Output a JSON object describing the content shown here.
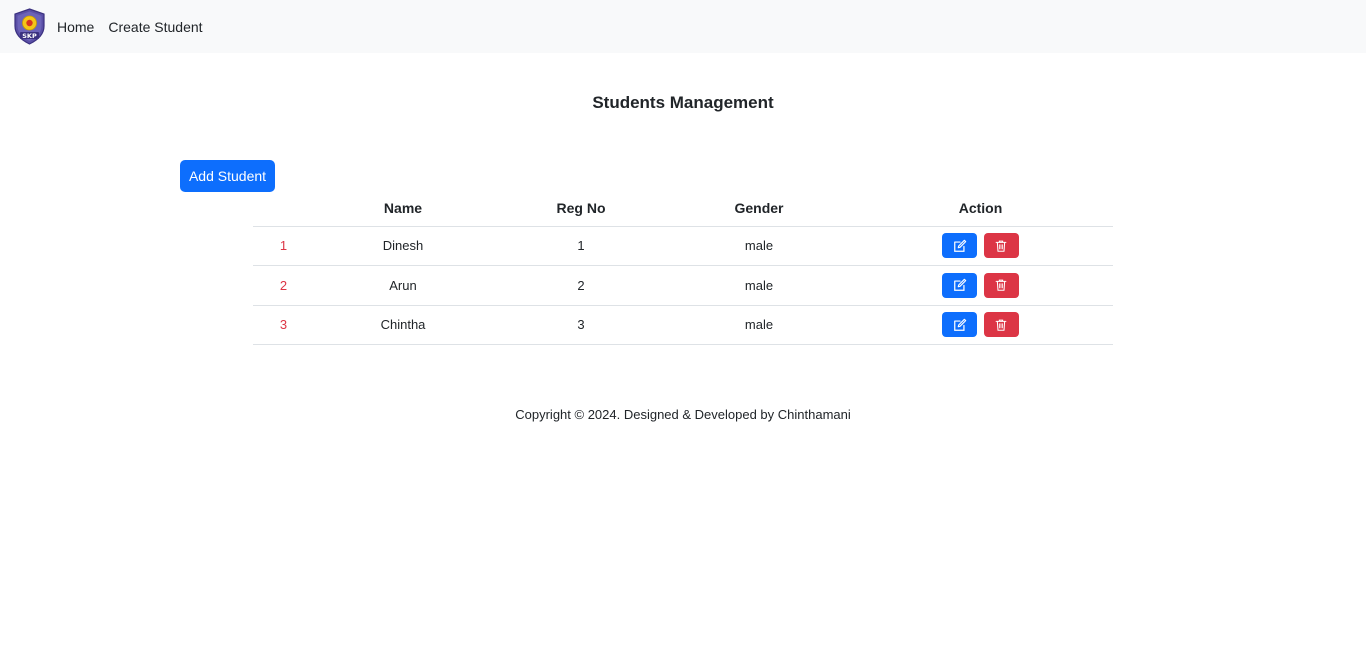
{
  "navbar": {
    "logo_text": "SKP",
    "links": [
      "Home",
      "Create Student"
    ]
  },
  "main": {
    "title": "Students Management",
    "add_button": "Add Student",
    "table": {
      "headers": [
        "",
        "Name",
        "Reg No",
        "Gender",
        "Action"
      ],
      "rows": [
        {
          "index": "1",
          "name": "Dinesh",
          "reg_no": "1",
          "gender": "male"
        },
        {
          "index": "2",
          "name": "Arun",
          "reg_no": "2",
          "gender": "male"
        },
        {
          "index": "3",
          "name": "Chintha",
          "reg_no": "3",
          "gender": "male"
        }
      ]
    }
  },
  "footer": {
    "text": "Copyright © 2024. Designed & Developed by Chinthamani"
  },
  "icons": {
    "edit": "edit-icon",
    "delete": "trash-icon"
  },
  "colors": {
    "primary": "#0d6efd",
    "danger": "#dc3545",
    "navbar_bg": "#f8f9fa"
  }
}
